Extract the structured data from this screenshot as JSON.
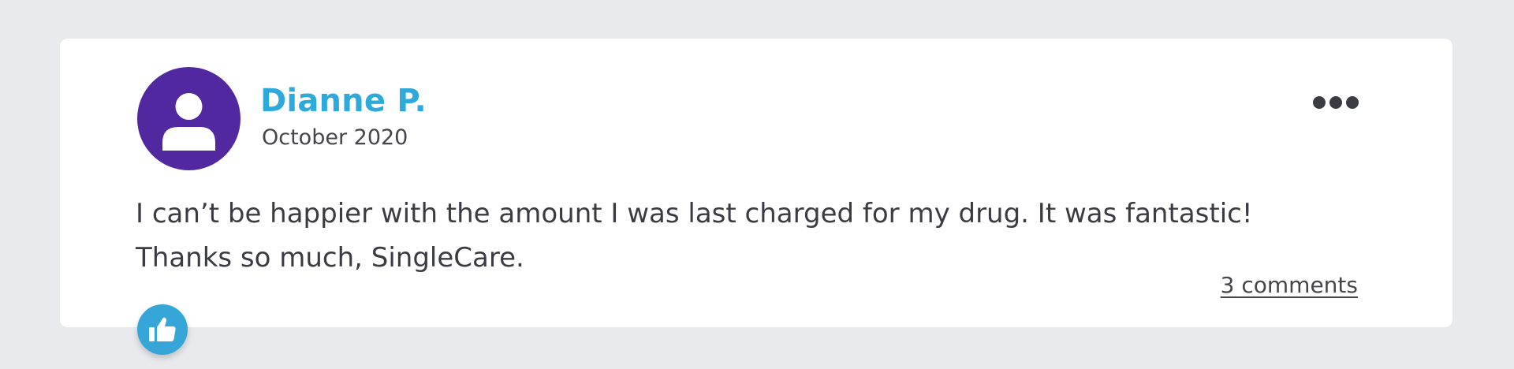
{
  "review": {
    "author": "Dianne P.",
    "date": "October 2020",
    "text_line1": "I can’t be happier with the amount I was last charged for my drug. It was fantastic!",
    "text_line2": "Thanks so much, SingleCare.",
    "comments_link": "3 comments"
  },
  "icons": {
    "avatar": "user-icon",
    "more": "more-dots-icon",
    "like": "thumbs-up-icon"
  },
  "colors": {
    "avatar_bg": "#5228a0",
    "author_name": "#2ea9dc",
    "like_button": "#36a6d8",
    "page_bg": "#e9eaed"
  }
}
